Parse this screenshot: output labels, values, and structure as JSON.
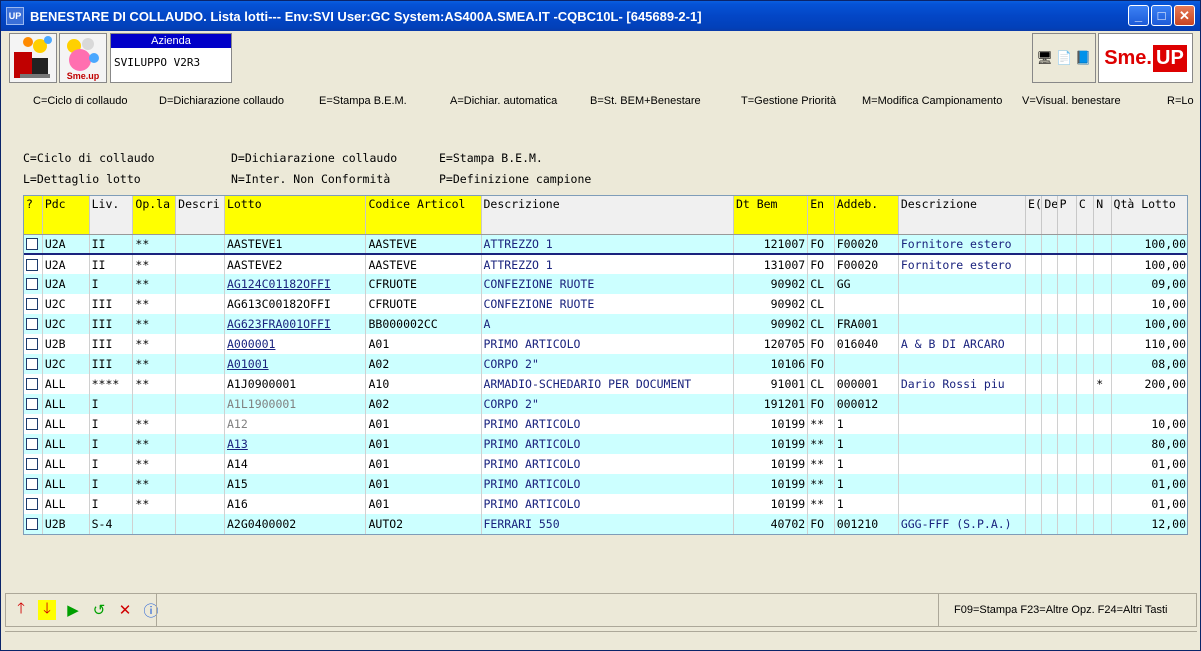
{
  "window": {
    "title": "BENESTARE DI COLLAUDO.  Lista lotti--- Env:SVI User:GC System:AS400A.SMEA.IT -CQBC10L- [645689-2-1]",
    "app_icon_text": "UP"
  },
  "header": {
    "company_label": "Azienda",
    "company_value": "SVILUPPO V2R3",
    "logo2_text": "Sme.up",
    "brand_sme": "Sme.",
    "brand_up": "UP"
  },
  "commands": [
    "C=Ciclo di collaudo",
    "D=Dichiarazione collaudo",
    "E=Stampa B.E.M.",
    "A=Dichiar. automatica",
    "B=St. BEM+Benestare",
    "T=Gestione Priorità",
    "M=Modifica Campionamento",
    "V=Visual. benestare",
    "R=Lo"
  ],
  "legend": {
    "row1": [
      "C=Ciclo di collaudo",
      "D=Dichiarazione collaudo",
      "E=Stampa B.E.M."
    ],
    "row2": [
      "L=Dettaglio lotto",
      "N=Inter. Non Conformità",
      "P=Definizione campione"
    ]
  },
  "grid": {
    "headers": [
      "?",
      "Pdc",
      "Liv.",
      "Op.la",
      "Descri",
      "Lotto",
      "Codice Articol",
      "Descrizione",
      "Dt Bem",
      "En",
      "Addeb.",
      "Descrizione",
      "E(",
      "De",
      "P",
      "C",
      "N",
      "Qtà Lotto"
    ],
    "rows": [
      [
        "U2A",
        "II",
        "**",
        "",
        "AASTEVE1",
        "AASTEVE",
        "ATTREZZO 1",
        "121007",
        "FO",
        "F00020",
        "Fornitore estero",
        "",
        "",
        "",
        "",
        "",
        "100,00"
      ],
      [
        "U2A",
        "II",
        "**",
        "",
        "AASTEVE2",
        "AASTEVE",
        "ATTREZZO 1",
        "131007",
        "FO",
        "F00020",
        "Fornitore estero",
        "",
        "",
        "",
        "",
        "",
        "100,00"
      ],
      [
        "U2A",
        "I",
        "**",
        "",
        "AG124C01182OFFI",
        "CFRUOTE",
        "CONFEZIONE RUOTE",
        "90902",
        "CL",
        "GG",
        "",
        "",
        "",
        "",
        "",
        "",
        "09,00"
      ],
      [
        "U2C",
        "III",
        "**",
        "",
        "AG613C00182OFFI",
        "CFRUOTE",
        "CONFEZIONE RUOTE",
        "90902",
        "CL",
        "",
        "",
        "",
        "",
        "",
        "",
        "",
        "10,00"
      ],
      [
        "U2C",
        "III",
        "**",
        "",
        "AG623FRA001OFFI",
        "BB000002CC",
        "A",
        "90902",
        "CL",
        "FRA001",
        "",
        "",
        "",
        "",
        "",
        "",
        "100,00"
      ],
      [
        "U2B",
        "III",
        "**",
        "",
        "A000001",
        "A01",
        "PRIMO ARTICOLO",
        "120705",
        "FO",
        "016040",
        "A & B DI ARCARO",
        "",
        "",
        "",
        "",
        "",
        "110,00"
      ],
      [
        "U2C",
        "III",
        "**",
        "",
        "A01001",
        "A02",
        "CORPO 2\"",
        "10106",
        "FO",
        "",
        "",
        "",
        "",
        "",
        "",
        "",
        "08,00"
      ],
      [
        "ALL",
        "****",
        "**",
        "",
        "A1J0900001",
        "A10",
        "ARMADIO-SCHEDARIO PER DOCUMENT",
        "91001",
        "CL",
        "000001",
        "Dario Rossi piu",
        "",
        "",
        "",
        "",
        "*",
        "200,00"
      ],
      [
        "ALL",
        "I",
        "",
        "",
        "A1L1900001",
        "A02",
        "CORPO 2\"",
        "191201",
        "FO",
        "000012",
        "",
        "",
        "",
        "",
        "",
        "",
        ""
      ],
      [
        "ALL",
        "I",
        "**",
        "",
        "A12",
        "A01",
        "PRIMO ARTICOLO",
        "10199",
        "**",
        "1",
        "",
        "",
        "",
        "",
        "",
        "",
        "10,00"
      ],
      [
        "ALL",
        "I",
        "**",
        "",
        "A13",
        "A01",
        "PRIMO ARTICOLO",
        "10199",
        "**",
        "1",
        "",
        "",
        "",
        "",
        "",
        "",
        "80,00"
      ],
      [
        "ALL",
        "I",
        "**",
        "",
        "A14",
        "A01",
        "PRIMO ARTICOLO",
        "10199",
        "**",
        "1",
        "",
        "",
        "",
        "",
        "",
        "",
        "01,00"
      ],
      [
        "ALL",
        "I",
        "**",
        "",
        "A15",
        "A01",
        "PRIMO ARTICOLO",
        "10199",
        "**",
        "1",
        "",
        "",
        "",
        "",
        "",
        "",
        "01,00"
      ],
      [
        "ALL",
        "I",
        "**",
        "",
        "A16",
        "A01",
        "PRIMO ARTICOLO",
        "10199",
        "**",
        "1",
        "",
        "",
        "",
        "",
        "",
        "",
        "01,00"
      ],
      [
        "U2B",
        "S-4",
        "",
        "",
        "A2G0400002",
        "AUTO2",
        "FERRARI 550",
        "40702",
        "FO",
        "001210",
        "GGG-FFF (S.P.A.)",
        "",
        "",
        "",
        "",
        "",
        "12,00"
      ]
    ]
  },
  "footer": {
    "fkeys": "F09=Stampa    F23=Altre Opz.    F24=Altri Tasti"
  },
  "colors": {
    "accent": "#0346c6",
    "header_yellow": "#ffff00",
    "row_alt": "#ccffff",
    "text_blue": "#1a237e"
  }
}
